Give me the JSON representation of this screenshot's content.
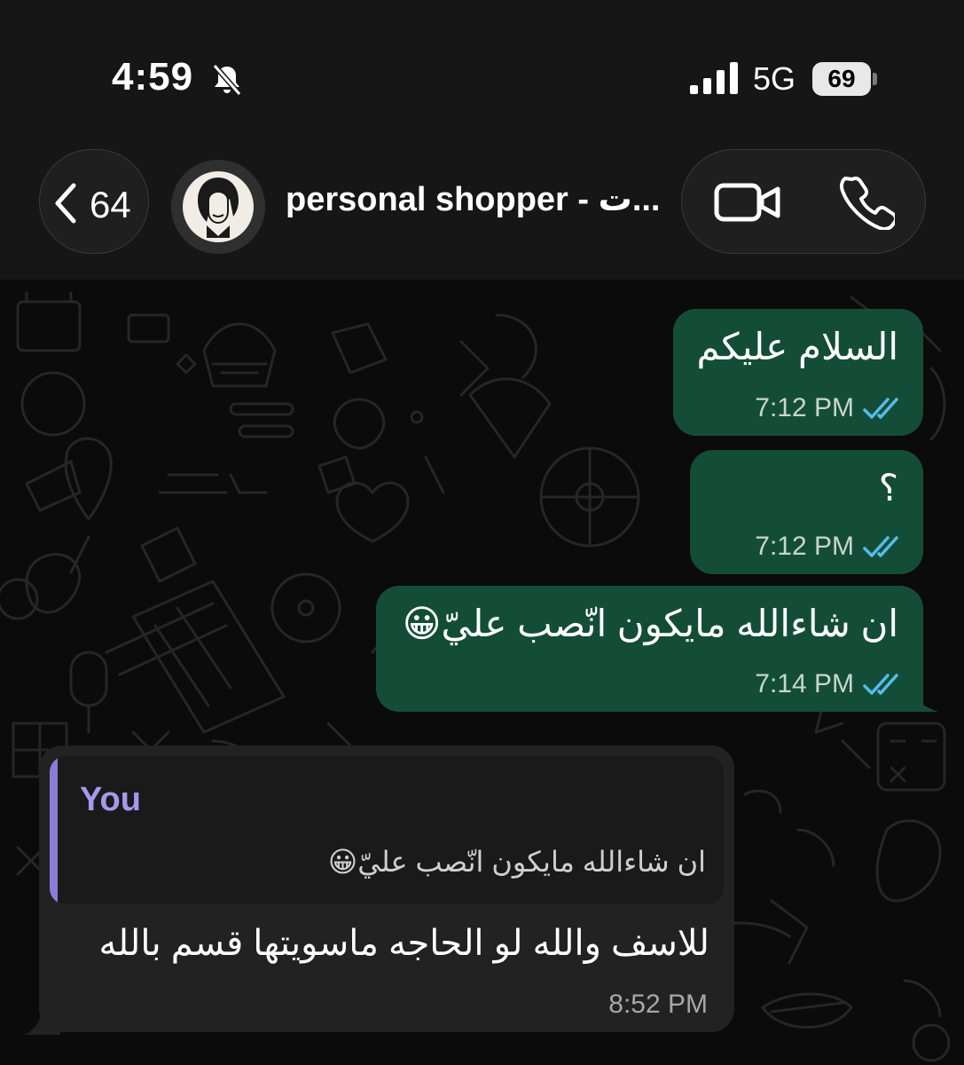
{
  "status_bar": {
    "time": "4:59",
    "network": "5G",
    "battery": "69",
    "icons": [
      "bell-slash-icon",
      "signal-icon",
      "battery-icon"
    ]
  },
  "header": {
    "unread_count": "64",
    "contact_name": "personal shopper - ت...",
    "icons": [
      "chevron-left-icon",
      "video-call-icon",
      "phone-icon"
    ]
  },
  "messages": [
    {
      "direction": "outgoing",
      "text": "السلام عليكم",
      "time": "7:12 PM",
      "status": "read"
    },
    {
      "direction": "outgoing",
      "text": "؟",
      "time": "7:12 PM",
      "status": "read"
    },
    {
      "direction": "outgoing",
      "text": "ان شاءالله مايكون انّصب عليّ😀",
      "time": "7:14 PM",
      "status": "read"
    },
    {
      "direction": "incoming",
      "quote": {
        "author": "You",
        "text": "ان شاءالله مايكون انّصب عليّ😀"
      },
      "text": "للاسف والله لو الحاجه ماسويتها قسم بالله",
      "time": "8:52 PM"
    }
  ],
  "colors": {
    "outgoing_bubble": "#144d37",
    "incoming_bubble": "#222222",
    "quote_accent": "#8e7bd8",
    "read_ticks": "#53bdeb"
  }
}
